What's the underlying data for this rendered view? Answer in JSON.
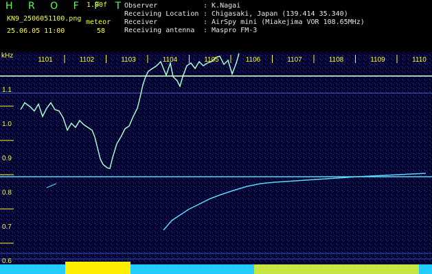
{
  "header": {
    "brand": "H R O F F T",
    "version": "1.00f",
    "filename": "KN9_2506051100.png",
    "meteor_label": "meteor",
    "timestamp": "25.06.05 11:00",
    "meteor_count": "58",
    "info": [
      {
        "label": "Observer",
        "value": ": K.Nagai"
      },
      {
        "label": "Receiving Location",
        "value": ": Chigasaki, Japan (139.414 35.340)"
      },
      {
        "label": "Receiver",
        "value": ": AirSpy mini (Miakejima VOR 108.65MHz)"
      },
      {
        "label": "Receiving antenna",
        "value": ": Maspro FM-3"
      }
    ]
  },
  "spectrogram": {
    "unit_label": "kHz",
    "time_ticks": [
      "1101",
      "1102",
      "1103",
      "1104",
      "1105",
      "1106",
      "1107",
      "1108",
      "1109",
      "1110"
    ],
    "freq_ticks": [
      "1.1",
      "1.0",
      "0.9",
      "0.8",
      "0.7",
      "0.6"
    ],
    "colors": {
      "bg": "#00002a",
      "text": "#ffff33",
      "trace": "#aaffcc",
      "line": "#55ddff",
      "bottom": "#22ccff",
      "meteor": "#ffee00"
    }
  }
}
